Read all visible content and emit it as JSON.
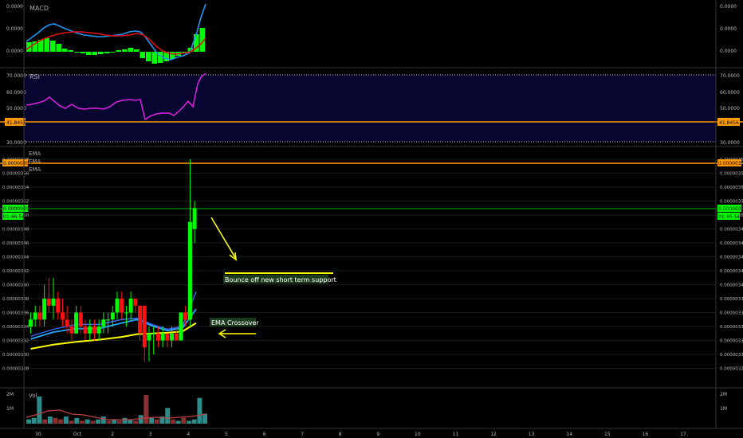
{
  "colors": {
    "background": "#000000",
    "grid": "#1b1b1b",
    "up": "#00ff00",
    "down": "#ff1111",
    "macd_line": "#2196f3",
    "signal_line": "#e01010",
    "rsi_line": "#e020e0",
    "rsi_band": "#060630",
    "ema_fast": "#3c6bff",
    "ema_mid": "#22aaff",
    "ema_slow": "#ffff00",
    "annotation_arrow": "#ffff00",
    "price_line": "#00cc00",
    "level_line": "#ff9900",
    "volume_up": "#2e8b8b",
    "volume_down": "#8b2e2e",
    "volume_ma": "#c04040"
  },
  "panes": {
    "macd": {
      "label": "MACD",
      "tick_labels": [
        "0.0000",
        "0.0000",
        "0.0000"
      ]
    },
    "rsi": {
      "label": "RSI",
      "tick_labels": [
        "70.0000",
        "60.0000",
        "50.0000",
        "30.0000"
      ],
      "level_badge": "41.8456"
    },
    "price": {
      "labels": [
        "EMA",
        "EMA",
        "EMA"
      ],
      "tick_labels": [
        "0.00000358",
        "0.00000356",
        "0.00000354",
        "0.00000352",
        "0.00000350",
        "0.00000348",
        "0.00000346",
        "0.00000344",
        "0.00000342",
        "0.00000340",
        "0.00000338",
        "0.00000336",
        "0.00000334",
        "0.00000332",
        "0.00000330",
        "0.00000328"
      ],
      "level_badge": "0.00000357",
      "last_price_badge": "0.00000351",
      "countdown_badge": "01:46:54"
    },
    "volume": {
      "label": "Vol",
      "tick_labels": [
        "2M",
        "1M"
      ]
    }
  },
  "annotations": {
    "support_text": "Bounce off new short term support",
    "crossover_text": "EMA Crossover"
  },
  "x_axis": {
    "labels": [
      "30",
      "Oct",
      "2",
      "3",
      "4",
      "5",
      "6",
      "7",
      "8",
      "9",
      "10",
      "11",
      "12",
      "13",
      "14",
      "15",
      "16",
      "17"
    ]
  },
  "chart_data": {
    "type": "candlestick",
    "x_unit": "day index (0 = Sep 30 midnight)",
    "candles": [
      {
        "t": -0.2,
        "o": 3.34,
        "h": 3.36,
        "l": 3.33,
        "c": 3.35
      },
      {
        "t": -0.08,
        "o": 3.35,
        "h": 3.37,
        "l": 3.34,
        "c": 3.36
      },
      {
        "t": 0.04,
        "o": 3.36,
        "h": 3.37,
        "l": 3.34,
        "c": 3.35
      },
      {
        "t": 0.16,
        "o": 3.35,
        "h": 3.4,
        "l": 3.34,
        "c": 3.38
      },
      {
        "t": 0.28,
        "o": 3.38,
        "h": 3.41,
        "l": 3.36,
        "c": 3.37
      },
      {
        "t": 0.4,
        "o": 3.37,
        "h": 3.41,
        "l": 3.35,
        "c": 3.38
      },
      {
        "t": 0.52,
        "o": 3.38,
        "h": 3.39,
        "l": 3.35,
        "c": 3.36
      },
      {
        "t": 0.64,
        "o": 3.36,
        "h": 3.38,
        "l": 3.34,
        "c": 3.35
      },
      {
        "t": 0.76,
        "o": 3.35,
        "h": 3.37,
        "l": 3.33,
        "c": 3.34
      },
      {
        "t": 0.88,
        "o": 3.34,
        "h": 3.35,
        "l": 3.32,
        "c": 3.33
      },
      {
        "t": 1.0,
        "o": 3.33,
        "h": 3.37,
        "l": 3.33,
        "c": 3.36
      },
      {
        "t": 1.12,
        "o": 3.36,
        "h": 3.37,
        "l": 3.33,
        "c": 3.34
      },
      {
        "t": 1.24,
        "o": 3.34,
        "h": 3.35,
        "l": 3.32,
        "c": 3.33
      },
      {
        "t": 1.36,
        "o": 3.33,
        "h": 3.35,
        "l": 3.32,
        "c": 3.34
      },
      {
        "t": 1.48,
        "o": 3.34,
        "h": 3.35,
        "l": 3.32,
        "c": 3.33
      },
      {
        "t": 1.6,
        "o": 3.33,
        "h": 3.35,
        "l": 3.32,
        "c": 3.34
      },
      {
        "t": 1.72,
        "o": 3.34,
        "h": 3.36,
        "l": 3.33,
        "c": 3.35
      },
      {
        "t": 1.84,
        "o": 3.35,
        "h": 3.36,
        "l": 3.33,
        "c": 3.35
      },
      {
        "t": 1.96,
        "o": 3.35,
        "h": 3.37,
        "l": 3.34,
        "c": 3.36
      },
      {
        "t": 2.08,
        "o": 3.36,
        "h": 3.39,
        "l": 3.35,
        "c": 3.38
      },
      {
        "t": 2.2,
        "o": 3.38,
        "h": 3.39,
        "l": 3.35,
        "c": 3.36
      },
      {
        "t": 2.32,
        "o": 3.36,
        "h": 3.37,
        "l": 3.34,
        "c": 3.36
      },
      {
        "t": 2.44,
        "o": 3.36,
        "h": 3.39,
        "l": 3.35,
        "c": 3.38
      },
      {
        "t": 2.56,
        "o": 3.38,
        "h": 3.38,
        "l": 3.36,
        "c": 3.37
      },
      {
        "t": 2.68,
        "o": 3.37,
        "h": 3.37,
        "l": 3.32,
        "c": 3.33
      },
      {
        "t": 2.8,
        "o": 3.37,
        "h": 3.37,
        "l": 3.29,
        "c": 3.31
      },
      {
        "t": 2.92,
        "o": 3.32,
        "h": 3.34,
        "l": 3.29,
        "c": 3.33
      },
      {
        "t": 3.04,
        "o": 3.33,
        "h": 3.34,
        "l": 3.3,
        "c": 3.33
      },
      {
        "t": 3.16,
        "o": 3.33,
        "h": 3.34,
        "l": 3.31,
        "c": 3.32
      },
      {
        "t": 3.28,
        "o": 3.32,
        "h": 3.34,
        "l": 3.31,
        "c": 3.33
      },
      {
        "t": 3.4,
        "o": 3.33,
        "h": 3.33,
        "l": 3.31,
        "c": 3.32
      },
      {
        "t": 3.52,
        "o": 3.32,
        "h": 3.34,
        "l": 3.31,
        "c": 3.33
      },
      {
        "t": 3.64,
        "o": 3.33,
        "h": 3.34,
        "l": 3.32,
        "c": 3.32
      },
      {
        "t": 3.76,
        "o": 3.32,
        "h": 3.36,
        "l": 3.32,
        "c": 3.36
      },
      {
        "t": 3.88,
        "o": 3.36,
        "h": 3.37,
        "l": 3.34,
        "c": 3.35
      },
      {
        "t": 4.0,
        "o": 3.35,
        "h": 3.58,
        "l": 3.34,
        "c": 3.49
      },
      {
        "t": 4.12,
        "o": 3.48,
        "h": 3.52,
        "l": 3.46,
        "c": 3.51
      }
    ],
    "price_units": "x 1e-6",
    "emas": [
      {
        "label": "EMA",
        "points": [
          [
            -0.2,
            3.326
          ],
          [
            0.4,
            3.336
          ],
          [
            1.0,
            3.343
          ],
          [
            1.6,
            3.343
          ],
          [
            2.2,
            3.35
          ],
          [
            2.6,
            3.352
          ],
          [
            3.0,
            3.343
          ],
          [
            3.4,
            3.336
          ],
          [
            3.8,
            3.34
          ],
          [
            4.16,
            3.39
          ]
        ]
      },
      {
        "label": "EMA",
        "points": [
          [
            -0.2,
            3.322
          ],
          [
            0.4,
            3.332
          ],
          [
            1.0,
            3.337
          ],
          [
            1.6,
            3.337
          ],
          [
            2.2,
            3.345
          ],
          [
            2.6,
            3.35
          ],
          [
            3.0,
            3.341
          ],
          [
            3.4,
            3.334
          ],
          [
            3.8,
            3.338
          ],
          [
            4.16,
            3.365
          ]
        ]
      },
      {
        "label": "EMA",
        "points": [
          [
            -0.2,
            3.308
          ],
          [
            0.4,
            3.314
          ],
          [
            1.0,
            3.318
          ],
          [
            1.6,
            3.321
          ],
          [
            2.2,
            3.325
          ],
          [
            2.6,
            3.329
          ],
          [
            3.0,
            3.33
          ],
          [
            3.4,
            3.331
          ],
          [
            3.8,
            3.333
          ],
          [
            4.16,
            3.345
          ]
        ]
      }
    ],
    "y_range": [
      3.27,
      3.585
    ],
    "x_range": [
      -0.35,
      17.6
    ]
  }
}
